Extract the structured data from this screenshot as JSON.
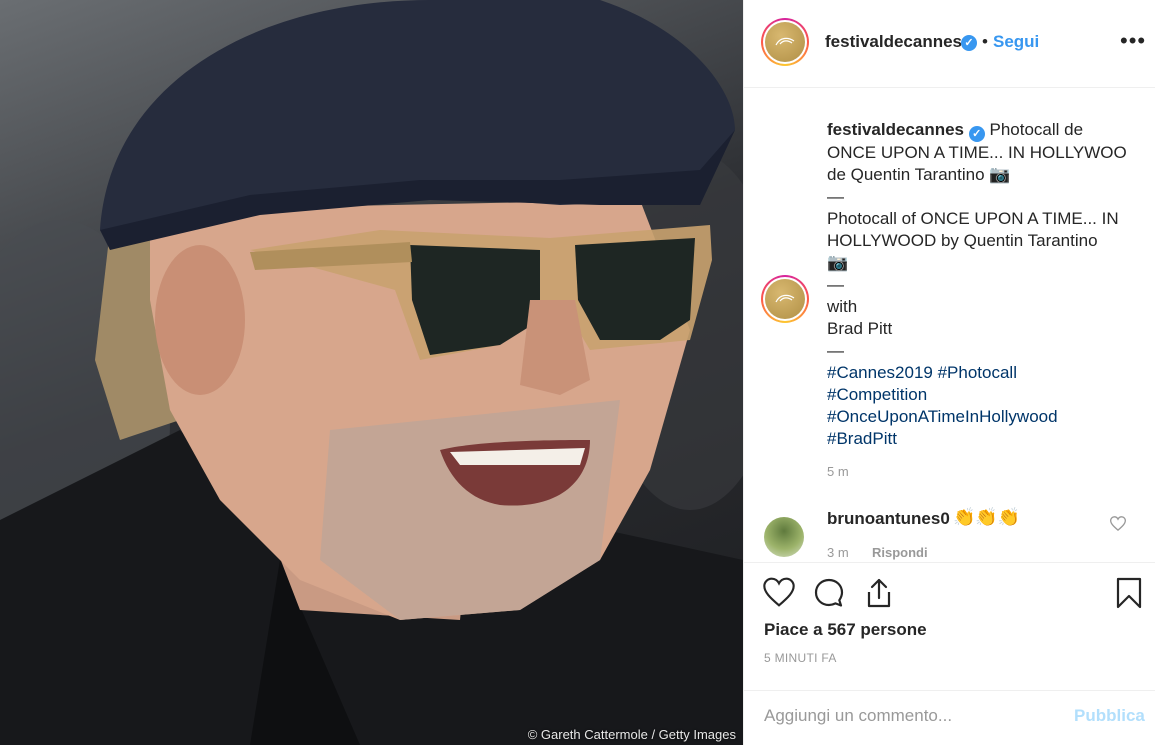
{
  "photo": {
    "credit": "© Gareth Cattermole / Getty Images"
  },
  "header": {
    "username": "festivaldecannes",
    "dot": "•",
    "follow_label": "Segui",
    "more_label": "•••",
    "verified_mark": "✓"
  },
  "caption": {
    "username": "festivaldecannes",
    "lines": [
      "Photocall de",
      "ONCE UPON A TIME... IN HOLLYWOO",
      "de Quentin Tarantino 📷",
      "—",
      "Photocall of ONCE UPON A TIME... IN",
      "HOLLYWOOD by Quentin Tarantino",
      "📷",
      "—",
      "with",
      "Brad Pitt",
      "—"
    ],
    "hashtags": [
      "#Cannes2019 #Photocall",
      "#Competition",
      "#OnceUponATimeInHollywood",
      "#BradPitt"
    ],
    "time": "5 m"
  },
  "comment": {
    "username": "brunoantunes0",
    "text": "👏👏👏",
    "time": "3 m",
    "reply_label": "Rispondi"
  },
  "actions": {
    "likes_text": "Piace a 567 persone",
    "timestamp": "5 MINUTI FA"
  },
  "composer": {
    "placeholder": "Aggiungi un commento...",
    "publish_label": "Pubblica"
  },
  "colors": {
    "link_blue": "#3897f0",
    "hashtag_blue": "#003569",
    "muted": "#999999",
    "publish_disabled": "#b2dffc"
  }
}
